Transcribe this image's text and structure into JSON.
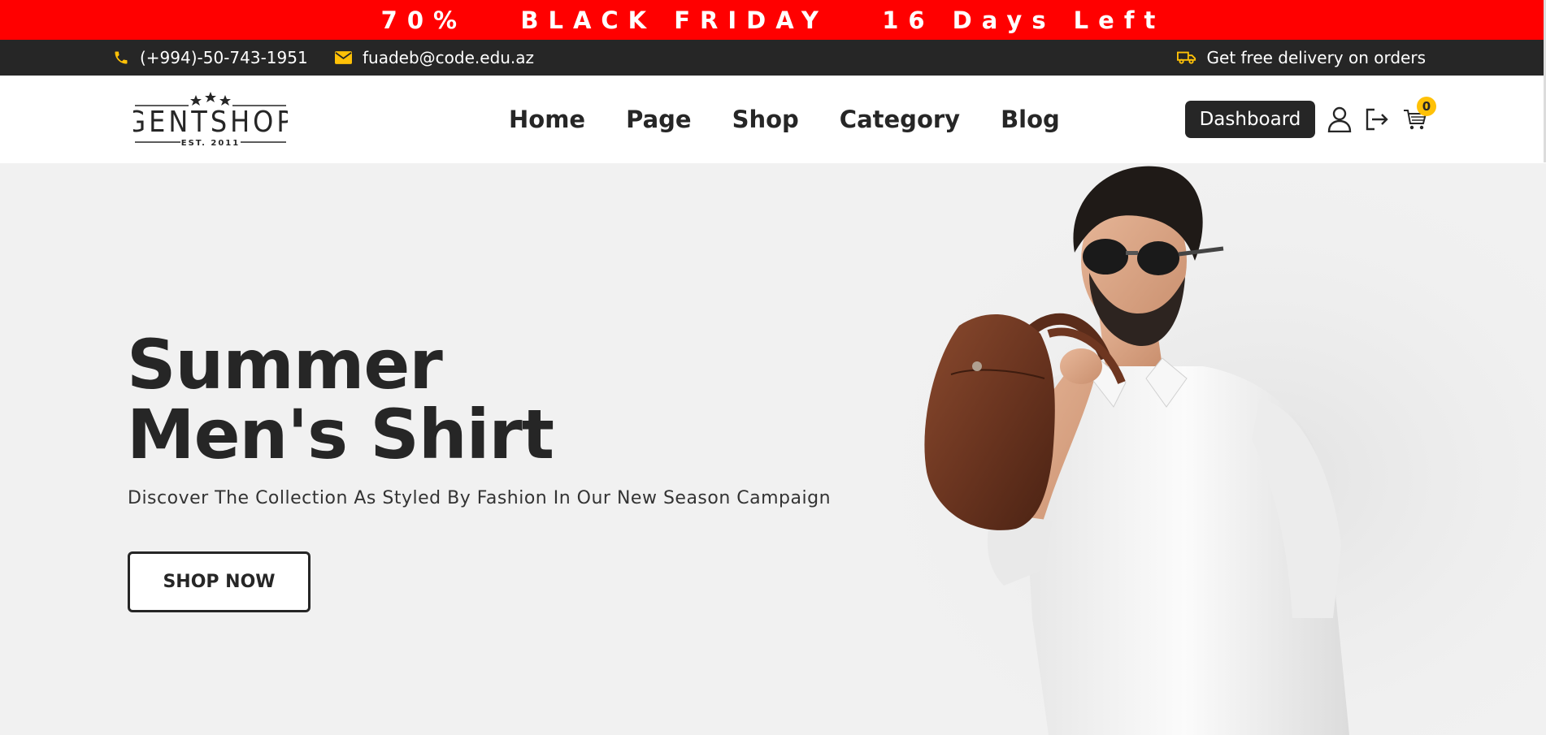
{
  "promo": {
    "text": "70%   BLACK FRIDAY   16 Days Left",
    "color": "#ff0000"
  },
  "contact": {
    "phone": "(+994)-50-743-1951",
    "email": "fuadeb@code.edu.az",
    "delivery": "Get free delivery on orders",
    "icon_color": "#ffc107"
  },
  "header": {
    "logo": {
      "brand": "GENTSHOP",
      "est": "EST. 2011"
    },
    "nav": [
      "Home",
      "Page",
      "Shop",
      "Category",
      "Blog"
    ],
    "dashboard_label": "Dashboard",
    "cart_count": "0",
    "icons": [
      "user-icon",
      "logout-icon",
      "cart-icon"
    ]
  },
  "hero": {
    "title_line1": "Summer",
    "title_line2": "Men's Shirt",
    "subtitle": "Discover The Collection As Styled By Fashion In Our New Season Campaign",
    "cta_label": "SHOP NOW",
    "background": "#f1f1f1"
  }
}
